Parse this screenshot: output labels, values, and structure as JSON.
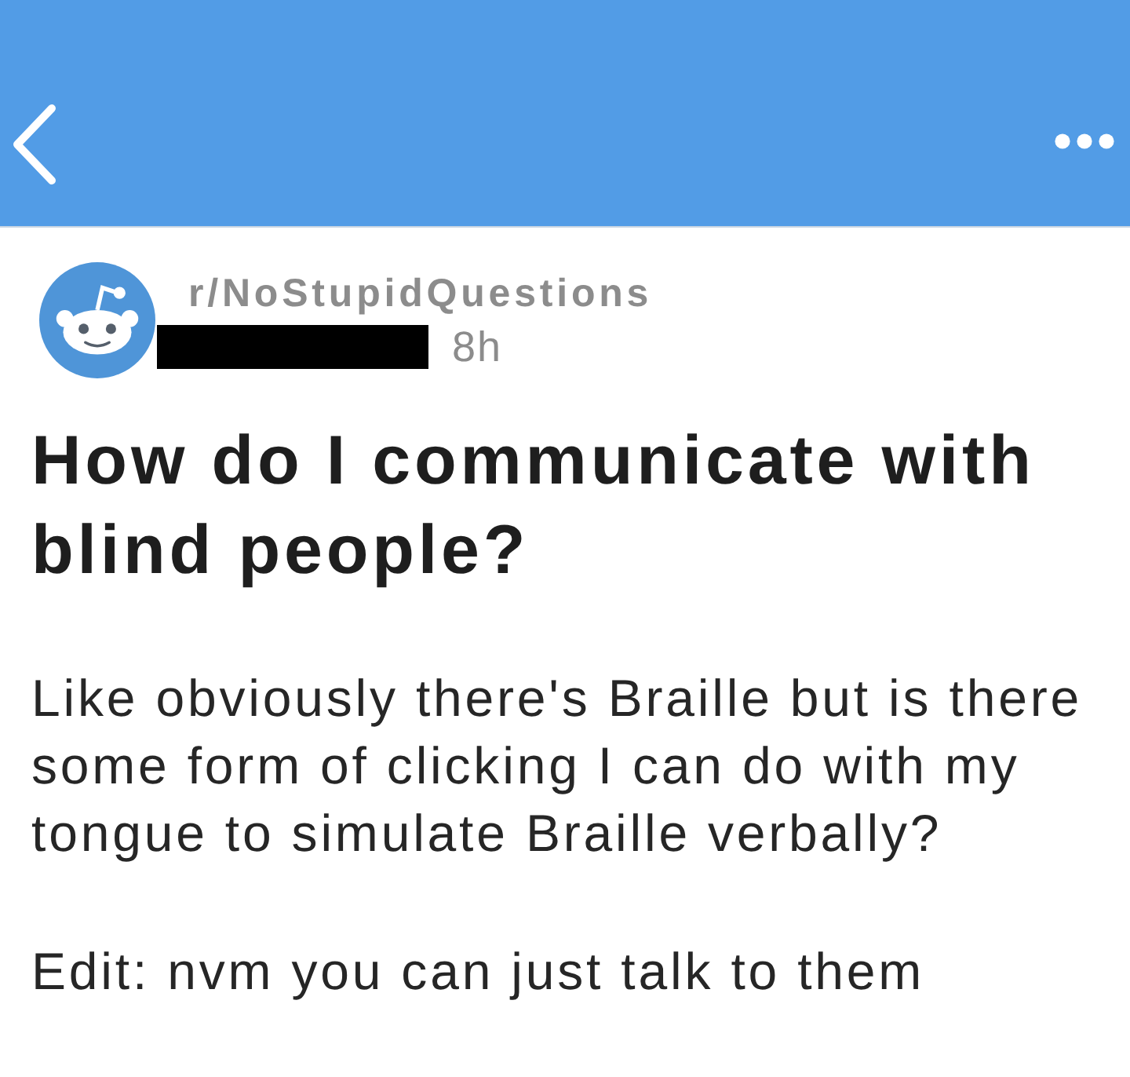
{
  "post": {
    "subreddit": "r/NoStupidQuestions",
    "age": "8h",
    "title": "How do I communicate with blind people?",
    "body": [
      "Like obviously there's Braille but is there some form of clicking I can do with my tongue to simulate Braille verbally?",
      "Edit: nvm you can just talk to them"
    ]
  }
}
